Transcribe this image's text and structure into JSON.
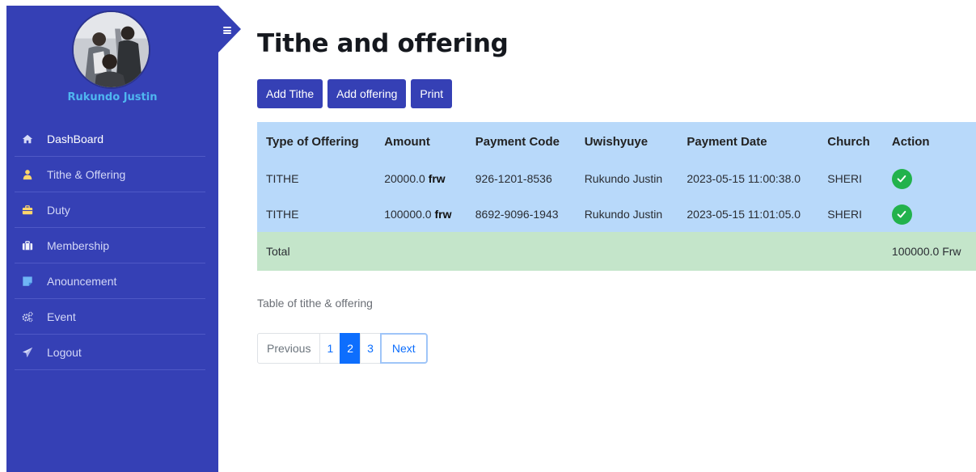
{
  "user": {
    "name": "Rukundo Justin"
  },
  "sidebar": {
    "items": [
      {
        "label": "DashBoard",
        "icon": "home-icon",
        "active": true
      },
      {
        "label": "Tithe & Offering",
        "icon": "user-icon",
        "active": false
      },
      {
        "label": "Duty",
        "icon": "briefcase-icon",
        "active": false
      },
      {
        "label": "Membership",
        "icon": "suitcase-icon",
        "active": false
      },
      {
        "label": "Anouncement",
        "icon": "note-icon",
        "active": false
      },
      {
        "label": "Event",
        "icon": "cogs-icon",
        "active": false
      },
      {
        "label": "Logout",
        "icon": "paper-plane-icon",
        "active": false
      }
    ]
  },
  "page": {
    "title": "Tithe and offering"
  },
  "toolbar": {
    "add_tithe_label": "Add Tithe",
    "add_offering_label": "Add offering",
    "print_label": "Print"
  },
  "table": {
    "headers": [
      "Type of Offering",
      "Amount",
      "Payment Code",
      "Uwishyuye",
      "Payment Date",
      "Church",
      "Action"
    ],
    "rows": [
      {
        "type": "TITHE",
        "amount": "20000.0",
        "currency": "frw",
        "code": "926-1201-8536",
        "payer": "Rukundo Justin",
        "date": "2023-05-15 11:00:38.0",
        "church": "SHERI"
      },
      {
        "type": "TITHE",
        "amount": "100000.0",
        "currency": "frw",
        "code": "8692-9096-1943",
        "payer": "Rukundo Justin",
        "date": "2023-05-15 11:01:05.0",
        "church": "SHERI"
      }
    ],
    "total_label": "Total",
    "total_value": "100000.0 Frw",
    "caption": "Table of tithe & offering"
  },
  "pagination": {
    "previous": "Previous",
    "pages": [
      "1",
      "2",
      "3"
    ],
    "current": "2",
    "next": "Next"
  },
  "colors": {
    "sidebar": "#3540b5",
    "header_row": "#b8d9fa",
    "total_row": "#c4e5ca",
    "check": "#22b24c",
    "user_name": "#4fb6f0"
  }
}
